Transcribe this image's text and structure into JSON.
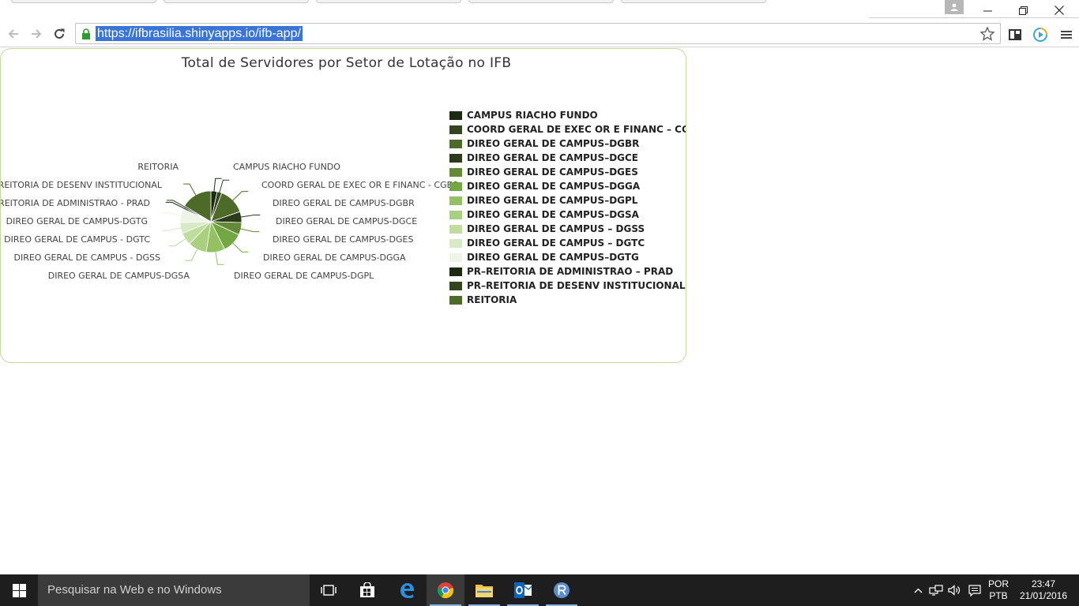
{
  "browser": {
    "url": "https://ifbrasilia.shinyapps.io/ifb-app/",
    "icons": {
      "back": "arrow-left-icon",
      "forward": "arrow-right-icon",
      "reload": "reload-icon",
      "lock": "lock-icon",
      "bookmark": "star-icon",
      "menu": "hamburger-menu-icon"
    }
  },
  "chart_data": {
    "type": "pie",
    "title": "Total de Servidores por Setor de Lotação no IFB",
    "legend_position": "right",
    "categories": [
      "CAMPUS RIACHO FUNDO",
      "COORD GERAL DE EXEC OR E FINANC - CGEO",
      "DIREO GERAL DE CAMPUS-DGBR",
      "DIREO GERAL DE CAMPUS-DGCE",
      "DIREO GERAL DE CAMPUS-DGES",
      "DIREO GERAL DE CAMPUS-DGGA",
      "DIREO GERAL DE CAMPUS-DGPL",
      "DIREO GERAL DE CAMPUS-DGSA",
      "DIREO GERAL DE CAMPUS - DGSS",
      "DIREO GERAL DE CAMPUS - DGTC",
      "DIREO GERAL DE CAMPUS-DGTG",
      "PR-REITORIA DE ADMINISTRAO - PRAD",
      "PR-REITORIA DE DESENV INSTITUCIONAL",
      "REITORIA"
    ],
    "legend_labels": [
      "CAMPUS RIACHO FUNDO",
      "COORD GERAL DE EXEC OR E FINANC – CGEO",
      "DIREO GERAL DE CAMPUS–DGBR",
      "DIREO GERAL DE CAMPUS–DGCE",
      "DIREO GERAL DE CAMPUS–DGES",
      "DIREO GERAL DE CAMPUS–DGGA",
      "DIREO GERAL DE CAMPUS–DGPL",
      "DIREO GERAL DE CAMPUS–DGSA",
      "DIREO GERAL DE CAMPUS – DGSS",
      "DIREO GERAL DE CAMPUS – DGTC",
      "DIREO GERAL DE CAMPUS–DGTG",
      "PR–REITORIA DE ADMINISTRAO – PRAD",
      "PR–REITORIA DE DESENV INSTITUCIONAL",
      "REITORIA"
    ],
    "slice_labels": [
      "CAMPUS RIACHO FUNDO",
      "COORD GERAL DE EXEC OR E FINANC - CGEO",
      "DIREO GERAL DE CAMPUS-DGBR",
      "DIREO GERAL DE CAMPUS-DGCE",
      "DIREO GERAL DE CAMPUS-DGES",
      "DIREO GERAL DE CAMPUS-DGGA",
      "DIREO GERAL DE CAMPUS-DGPL",
      "DIREO GERAL DE CAMPUS-DGSA",
      "DIREO GERAL DE CAMPUS - DGSS",
      "DIREO GERAL DE CAMPUS - DGTC",
      "DIREO GERAL DE CAMPUS-DGTG",
      "-REITORIA DE ADMINISTRAO - PRAD",
      "-REITORIA DE DESENV INSTITUCIONAL",
      "REITORIA"
    ],
    "values": [
      4,
      3,
      17,
      7,
      8,
      13,
      12,
      12,
      8,
      7,
      9,
      1,
      1,
      20
    ],
    "colors": [
      "#1c2a12",
      "#33441f",
      "#4e6a28",
      "#2c3b1a",
      "#648a38",
      "#72a743",
      "#94c164",
      "#a9d07e",
      "#c0dc9f",
      "#d8e9c6",
      "#eef5e8",
      "#1c2a12",
      "#33441f",
      "#4e6a28"
    ]
  },
  "taskbar": {
    "search_placeholder": "Pesquisar na Web e no Windows",
    "language_line1": "POR",
    "language_line2": "PTB",
    "time": "23:47",
    "date": "21/01/2016"
  }
}
